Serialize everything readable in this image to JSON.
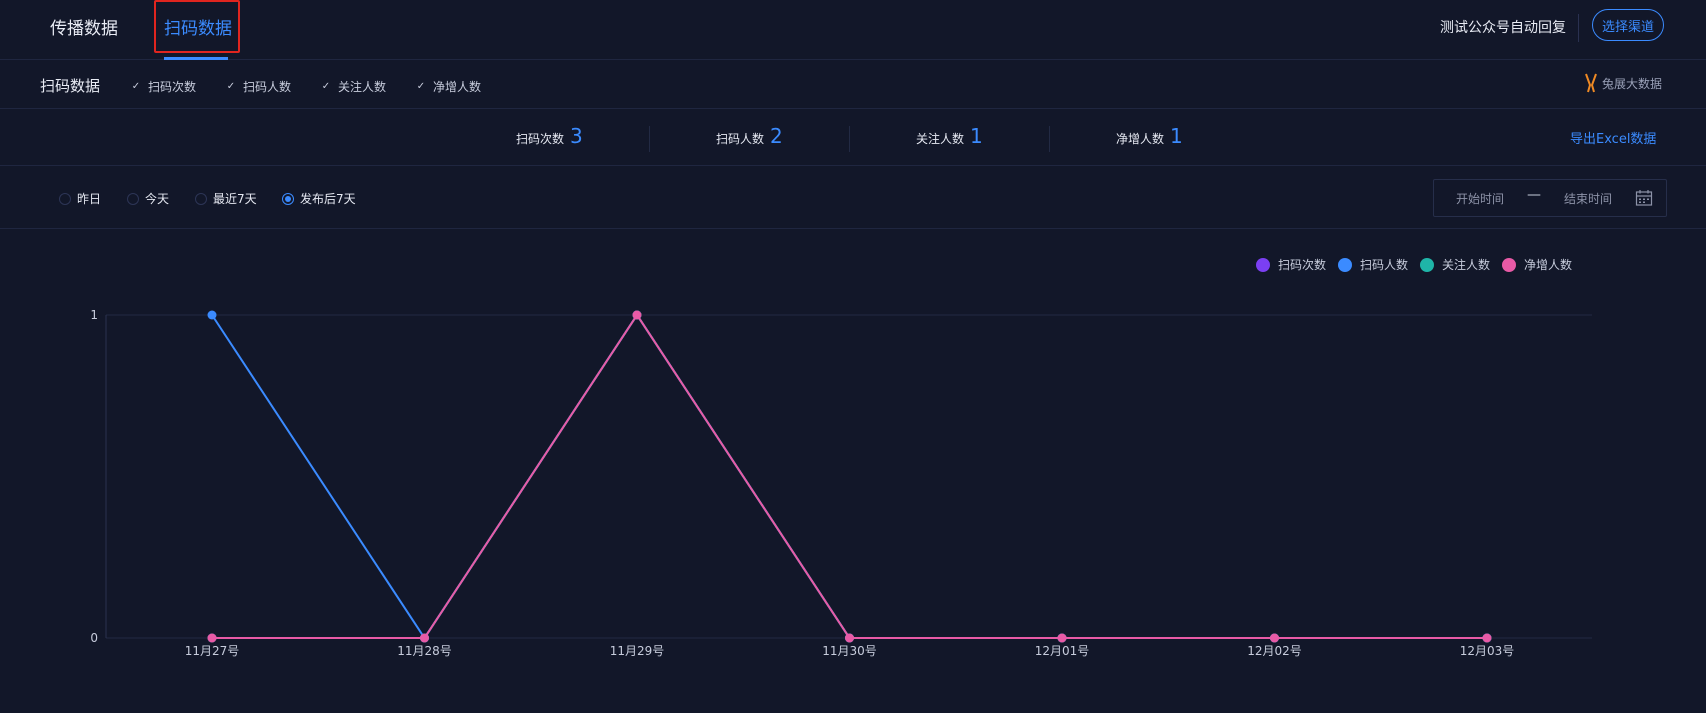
{
  "tabs": [
    {
      "label": "传播数据",
      "active": false
    },
    {
      "label": "扫码数据",
      "active": true
    }
  ],
  "header": {
    "account_name": "测试公众号自动回复",
    "channel_button": "选择渠道"
  },
  "section": {
    "title": "扫码数据",
    "checkboxes": [
      "扫码次数",
      "扫码人数",
      "关注人数",
      "净增人数"
    ],
    "brand": "兔展大数据"
  },
  "summary": {
    "stats": [
      {
        "label": "扫码次数",
        "value": "3"
      },
      {
        "label": "扫码人数",
        "value": "2"
      },
      {
        "label": "关注人数",
        "value": "1"
      },
      {
        "label": "净增人数",
        "value": "1"
      }
    ],
    "export_label": "导出Excel数据"
  },
  "filter": {
    "options": [
      "昨日",
      "今天",
      "最近7天",
      "发布后7天"
    ],
    "selected": "发布后7天",
    "start_placeholder": "开始时间",
    "separator": "—",
    "end_placeholder": "结束时间"
  },
  "colors": {
    "accent": "#3b8bff",
    "scan_count": "#7b3ff2",
    "scan_people": "#3b8bff",
    "follow_people": "#1fb5a8",
    "net_growth": "#e85aa6"
  },
  "chart_data": {
    "type": "line",
    "categories": [
      "11月27号",
      "11月28号",
      "11月29号",
      "11月30号",
      "12月01号",
      "12月02号",
      "12月03号"
    ],
    "series": [
      {
        "name": "扫码次数",
        "color": "#7b3ff2",
        "values": [
          0,
          0,
          1,
          0,
          0,
          0,
          0
        ]
      },
      {
        "name": "扫码人数",
        "color": "#3b8bff",
        "values": [
          1,
          0,
          1,
          0,
          0,
          0,
          0
        ]
      },
      {
        "name": "关注人数",
        "color": "#1fb5a8",
        "values": [
          0,
          0,
          1,
          0,
          0,
          0,
          0
        ]
      },
      {
        "name": "净增人数",
        "color": "#e85aa6",
        "values": [
          0,
          0,
          1,
          0,
          0,
          0,
          0
        ]
      }
    ],
    "y_ticks": [
      "0",
      "1"
    ],
    "ylim": [
      0,
      1
    ],
    "legend_position": "top-right",
    "grid": true
  }
}
